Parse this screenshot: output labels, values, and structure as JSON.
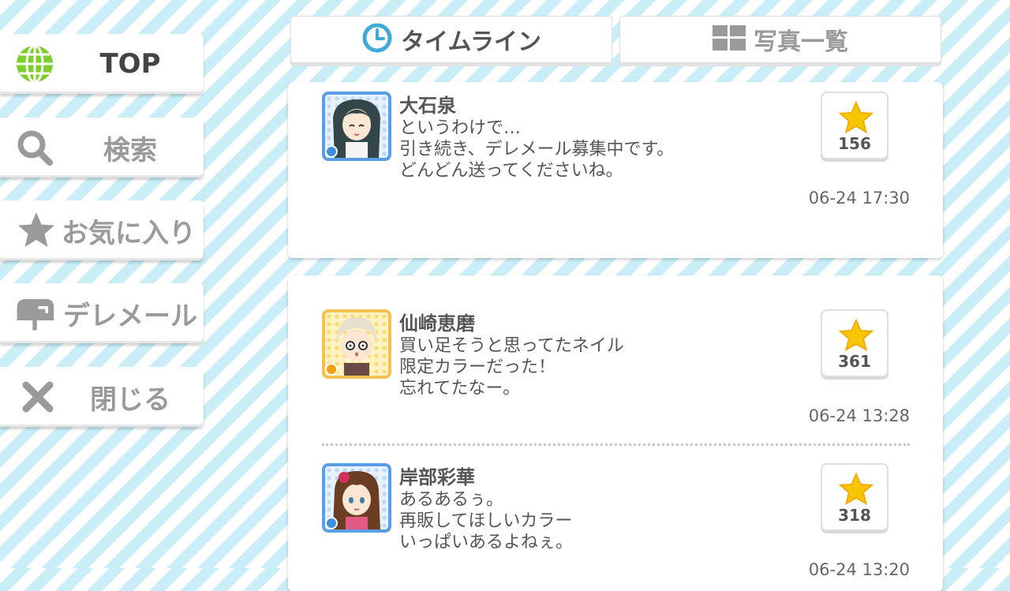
{
  "sidebar": {
    "items": [
      {
        "label": "TOP",
        "icon": "globe-icon",
        "active": true
      },
      {
        "label": "検索",
        "icon": "search-icon"
      },
      {
        "label": "お気に入り",
        "icon": "star-icon"
      },
      {
        "label": "デレメール",
        "icon": "mailbox-icon"
      },
      {
        "label": "閉じる",
        "icon": "close-icon"
      }
    ]
  },
  "tabs": [
    {
      "label": "タイムライン",
      "icon": "clock-icon",
      "active": true
    },
    {
      "label": "写真一覧",
      "icon": "grid-icon"
    }
  ],
  "posts": [
    {
      "name": "大石泉",
      "message": "というわけで…\n引き続き、デレメール募集中です。\nどんどん送ってくださいね。",
      "likes": "156",
      "time": "06-24 17:30"
    },
    {
      "name": "仙崎恵磨",
      "message": "買い足そうと思ってたネイル\n限定カラーだった！\n忘れてたなー。",
      "likes": "361",
      "time": "06-24 13:28"
    },
    {
      "name": "岸部彩華",
      "message": "あるあるぅ。\n再販してほしいカラー\nいっぱいあるよねぇ。",
      "likes": "318",
      "time": "06-24 13:20"
    }
  ],
  "colors": {
    "accent_blue": "#3fa9d8",
    "star": "#f7c600",
    "globe": "#7ccf2a"
  }
}
